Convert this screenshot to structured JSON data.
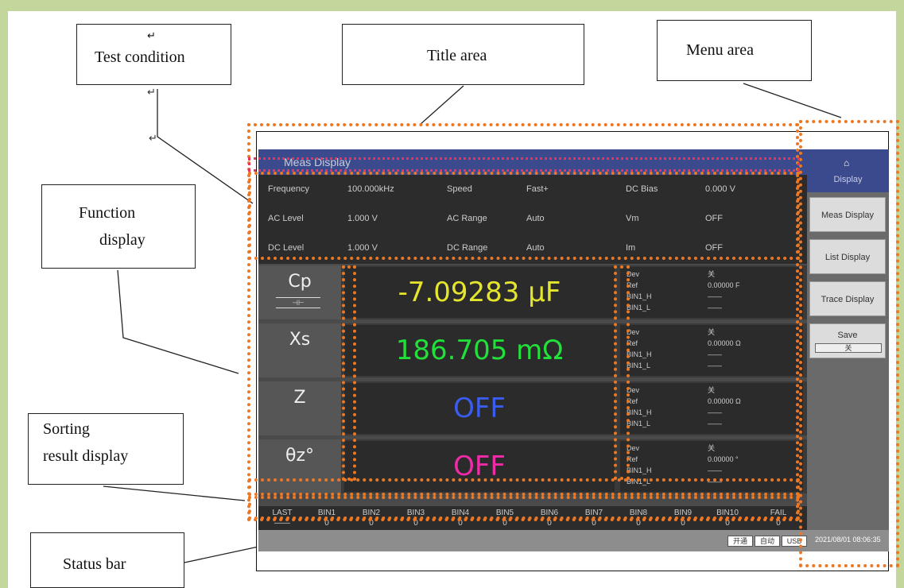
{
  "callouts": {
    "test_condition": "Test condition",
    "title_area": "Title area",
    "menu_area": "Menu area",
    "function_display_1": "Function",
    "function_display_2": "display",
    "sorting_result_1": "Sorting",
    "sorting_result_2": "result display",
    "status_bar": "Status bar",
    "return_mark": "↵"
  },
  "screen": {
    "title": "Meas Display",
    "conditions": [
      {
        "label": "Frequency",
        "value": "100.000kHz"
      },
      {
        "label": "Speed",
        "value": "Fast+"
      },
      {
        "label": "DC Bias",
        "value": "0.000 V"
      },
      {
        "label": "AC Level",
        "value": "1.000 V"
      },
      {
        "label": "AC Range",
        "value": "Auto"
      },
      {
        "label": "Vm",
        "value": "OFF"
      },
      {
        "label": "DC Level",
        "value": "1.000 V"
      },
      {
        "label": "DC Range",
        "value": "Auto"
      },
      {
        "label": "Im",
        "value": "OFF"
      }
    ],
    "functions": [
      {
        "name": "Cp",
        "symbol": "⊣⊢",
        "value": "-7.09283 μF",
        "color": "#e5e52e",
        "dev": "关",
        "ref": "0.00000 F"
      },
      {
        "name": "Xs",
        "symbol": "",
        "value": "186.705 mΩ",
        "color": "#22e03a",
        "dev": "关",
        "ref": "0.00000 Ω"
      },
      {
        "name": "Z",
        "symbol": "",
        "value": "OFF",
        "color": "#3b5cf0",
        "dev": "关",
        "ref": "0.00000 Ω"
      },
      {
        "name": "θz°",
        "symbol": "",
        "value": "OFF",
        "color": "#f02aa8",
        "dev": "关",
        "ref": "0.00000 °"
      }
    ],
    "info_labels": [
      "Dev",
      "Ref",
      "BIN1_H",
      "BIN1_L"
    ],
    "info_dash": "——",
    "bins": [
      {
        "name": "LAST",
        "count": "——"
      },
      {
        "name": "BIN1",
        "count": "0"
      },
      {
        "name": "BIN2",
        "count": "0"
      },
      {
        "name": "BIN3",
        "count": "0"
      },
      {
        "name": "BIN4",
        "count": "0"
      },
      {
        "name": "BIN5",
        "count": "0"
      },
      {
        "name": "BIN6",
        "count": "0"
      },
      {
        "name": "BIN7",
        "count": "0"
      },
      {
        "name": "BIN8",
        "count": "0"
      },
      {
        "name": "BIN9",
        "count": "0"
      },
      {
        "name": "BIN10",
        "count": "0"
      },
      {
        "name": "FAIL",
        "count": "0"
      }
    ],
    "status": {
      "chip1": "开通",
      "chip2": "自动",
      "chip3": "USB",
      "datetime": "2021/08/01 08:06:35"
    },
    "menu": {
      "display_label": "Display",
      "home_icon": "home-icon",
      "buttons": [
        "Meas Display",
        "List Display",
        "Trace Display"
      ],
      "save_label": "Save",
      "save_value": "关"
    }
  },
  "colors": {
    "background": "#c3d69b",
    "dotted_frame": "#ee7722",
    "title_dotted": "#e8335a",
    "title_bar": "#3b4a8c"
  }
}
